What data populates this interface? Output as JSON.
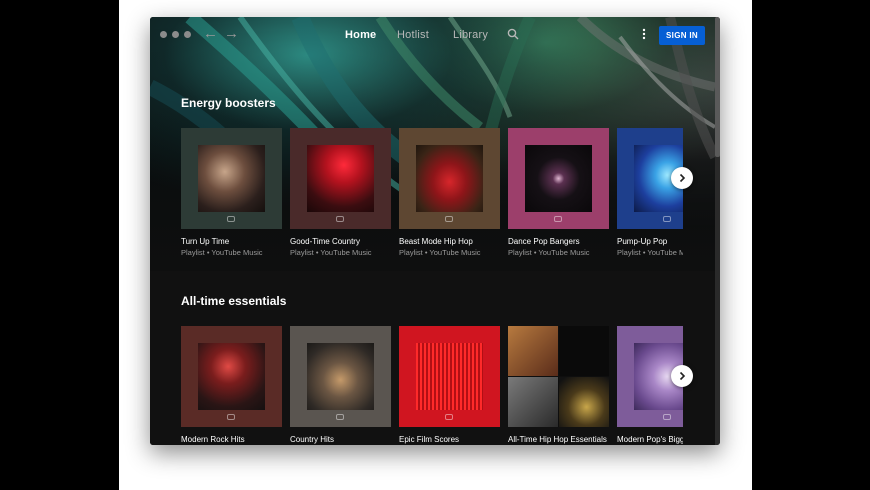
{
  "nav": {
    "tabs": [
      {
        "label": "Home",
        "active": true
      },
      {
        "label": "Hotlist",
        "active": false
      },
      {
        "label": "Library",
        "active": false
      }
    ],
    "search_icon": "search-icon",
    "more_icon": "more-vert-icon",
    "sign_in_label": "SIGN IN",
    "back_icon": "arrow-left-icon",
    "forward_icon": "arrow-right-icon"
  },
  "colors": {
    "accent": "#065fd4",
    "background": "#181818"
  },
  "sections": [
    {
      "title": "Energy boosters",
      "items": [
        {
          "title": "Turn Up Time",
          "subtitle": "Playlist • YouTube Music"
        },
        {
          "title": "Good-Time Country",
          "subtitle": "Playlist • YouTube Music"
        },
        {
          "title": "Beast Mode Hip Hop",
          "subtitle": "Playlist • YouTube Music"
        },
        {
          "title": "Dance Pop Bangers",
          "subtitle": "Playlist • YouTube Music"
        },
        {
          "title": "Pump-Up Pop",
          "subtitle": "Playlist • YouTube M"
        }
      ]
    },
    {
      "title": "All-time essentials",
      "items": [
        {
          "title": "Modern Rock Hits"
        },
        {
          "title": "Country Hits"
        },
        {
          "title": "Epic Film Scores"
        },
        {
          "title": "All-Time Hip Hop Essentials"
        },
        {
          "title": "Modern Pop's Bigg"
        }
      ]
    }
  ]
}
